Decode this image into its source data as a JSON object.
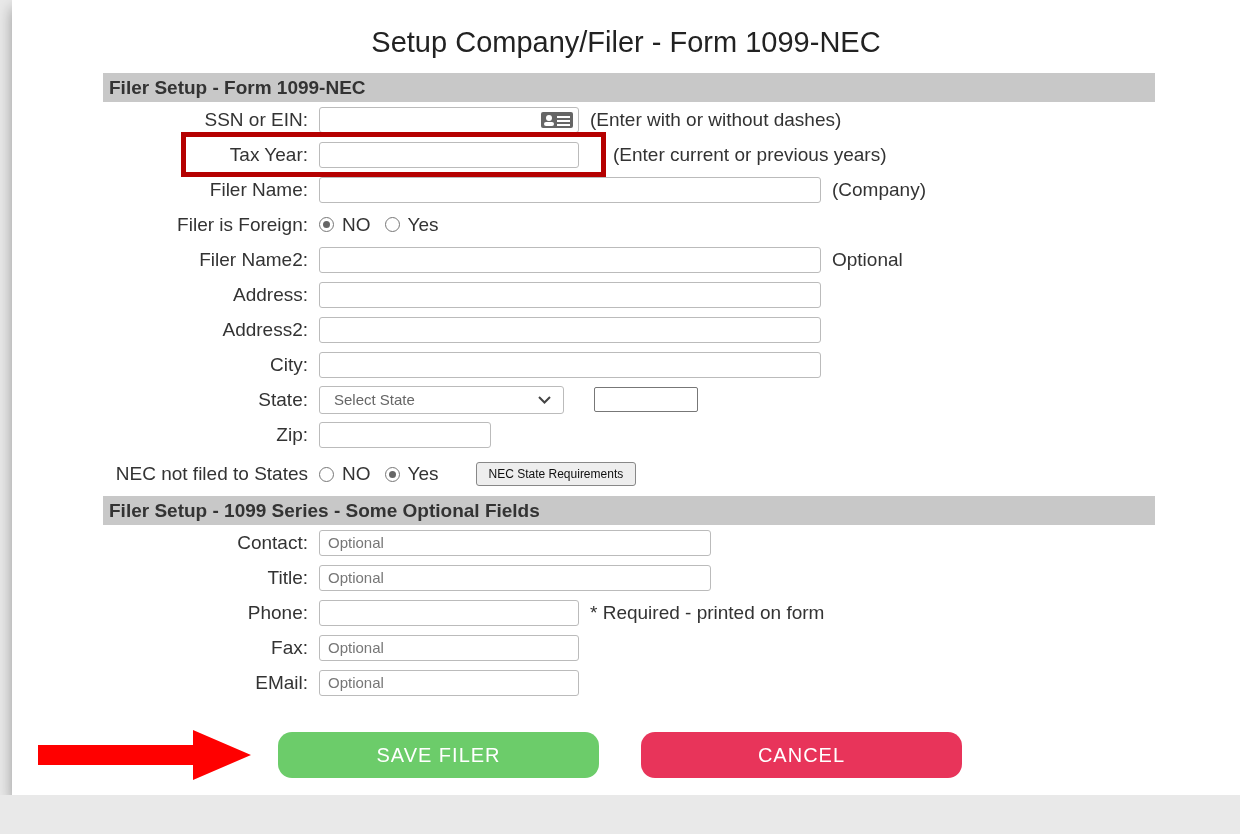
{
  "title": "Setup Company/Filer - Form 1099-NEC",
  "sections": [
    {
      "heading": "Filer Setup - Form 1099-NEC",
      "rows": [
        {
          "kind": "medium",
          "label": "SSN or EIN:",
          "card_icon": true,
          "hint": "(Enter with or without dashes)",
          "highlighted": false
        },
        {
          "kind": "medium",
          "label": "Tax Year:",
          "hint": "(Enter current or previous years)",
          "highlighted": true
        },
        {
          "kind": "long",
          "label": "Filer Name:",
          "hint": "(Company)",
          "highlighted": false
        },
        {
          "kind": "radio",
          "label": "Filer is Foreign:",
          "options": [
            {
              "label": "NO",
              "selected": true
            },
            {
              "label": "Yes",
              "selected": false
            }
          ]
        },
        {
          "kind": "long",
          "label": "Filer Name2:",
          "hint": "Optional",
          "highlighted": false
        },
        {
          "kind": "long",
          "label": "Address:",
          "highlighted": false
        },
        {
          "kind": "long",
          "label": "Address2:",
          "highlighted": false
        },
        {
          "kind": "long",
          "label": "City:",
          "highlighted": false
        },
        {
          "kind": "select",
          "label": "State:",
          "placeholder": "Select State"
        },
        {
          "kind": "short",
          "label": "Zip:",
          "highlighted": false
        },
        {
          "kind": "radio",
          "label": "NEC not filed to States",
          "options": [
            {
              "label": "NO",
              "selected": false
            },
            {
              "label": "Yes",
              "selected": true
            }
          ],
          "button": "NEC State Requirements"
        }
      ]
    },
    {
      "heading": "Filer Setup - 1099 Series - Some Optional Fields",
      "rows": [
        {
          "kind": "wide",
          "label": "Contact:",
          "placeholder": "Optional",
          "highlighted": false
        },
        {
          "kind": "wide",
          "label": "Title:",
          "placeholder": "Optional",
          "highlighted": false
        },
        {
          "kind": "medium",
          "label": "Phone:",
          "hint": "* Required - printed on form",
          "highlighted": false
        },
        {
          "kind": "medium",
          "label": "Fax:",
          "placeholder": "Optional",
          "highlighted": false
        },
        {
          "kind": "medium",
          "label": "EMail:",
          "placeholder": "Optional",
          "highlighted": false
        }
      ]
    }
  ],
  "buttons": [
    {
      "label": "SAVE FILER",
      "kind": "save",
      "pointed": true
    },
    {
      "label": "CANCEL",
      "kind": "cancel",
      "pointed": false
    }
  ]
}
